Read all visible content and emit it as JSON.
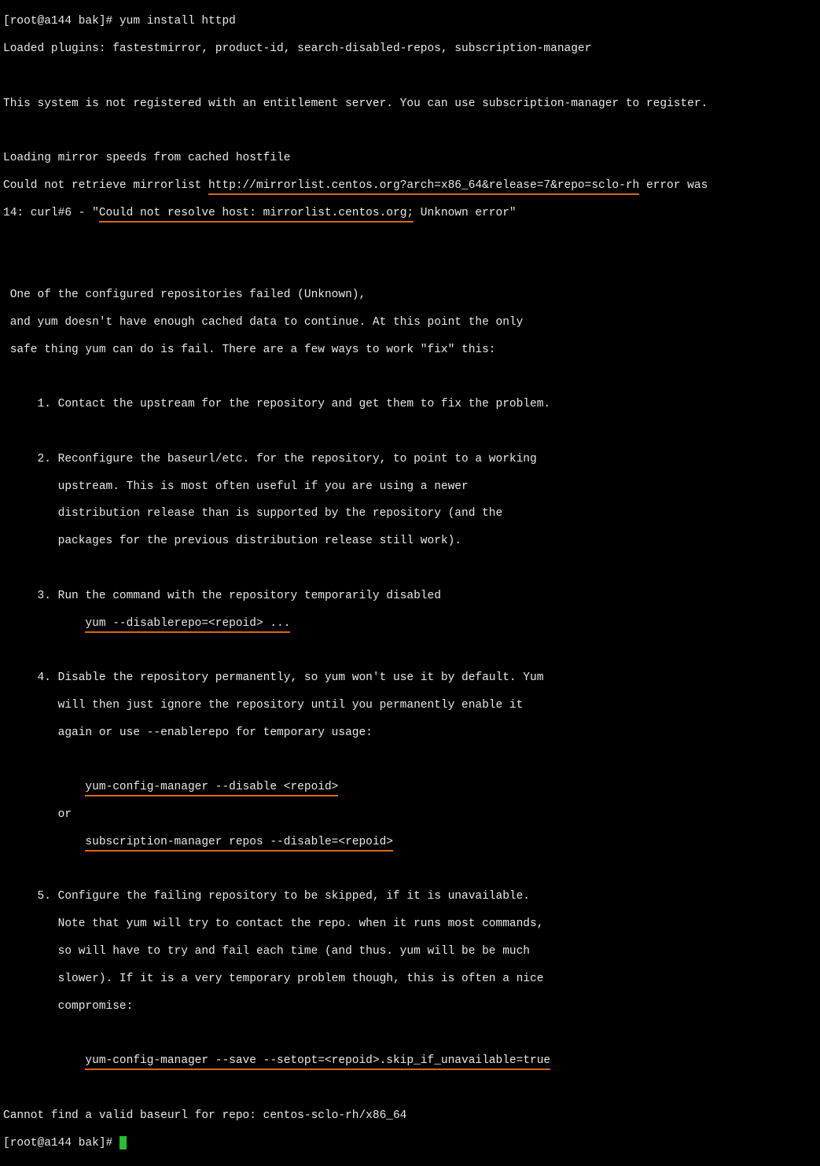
{
  "prompt1_user": "[root@a144 bak]# ",
  "cmd1": "yum install httpd",
  "line_plugins": "Loaded plugins: fastestmirror, product-id, search-disabled-repos, subscription-manager",
  "blank": "",
  "line_not_registered": "This system is not registered with an entitlement server. You can use subscription-manager to register.",
  "line_loading_mirror": "Loading mirror speeds from cached hostfile",
  "line_could_not_retrieve_pre": "Could not retrieve mirrorlist ",
  "underlined_url": "http://mirrorlist.centos.org?arch=x86_64&release=7&repo=sclo-rh",
  "line_could_not_retrieve_post": " error was",
  "line_curl_pre": "14: curl#6 - \"",
  "underlined_curl_msg": "Could not resolve host: mirrorlist.centos.org;",
  "line_curl_post": " Unknown error\"",
  "para1_l1": " One of the configured repositories failed (Unknown),",
  "para1_l2": " and yum doesn't have enough cached data to continue. At this point the only",
  "para1_l3": " safe thing yum can do is fail. There are a few ways to work \"fix\" this:",
  "opt1": "     1. Contact the upstream for the repository and get them to fix the problem.",
  "opt2_l1": "     2. Reconfigure the baseurl/etc. for the repository, to point to a working",
  "opt2_l2": "        upstream. This is most often useful if you are using a newer",
  "opt2_l3": "        distribution release than is supported by the repository (and the",
  "opt2_l4": "        packages for the previous distribution release still work).",
  "opt3_l1": "     3. Run the command with the repository temporarily disabled",
  "opt3_cmd_indent": "            ",
  "opt3_cmd": "yum --disablerepo=<repoid> ...",
  "opt4_l1": "     4. Disable the repository permanently, so yum won't use it by default. Yum",
  "opt4_l2": "        will then just ignore the repository until you permanently enable it",
  "opt4_l3": "        again or use --enablerepo for temporary usage:",
  "opt4_cmd1_indent": "            ",
  "opt4_cmd1": "yum-config-manager --disable <repoid>",
  "opt4_or": "        or",
  "opt4_cmd2_indent": "            ",
  "opt4_cmd2": "subscription-manager repos --disable=<repoid>",
  "opt5_l1": "     5. Configure the failing repository to be skipped, if it is unavailable.",
  "opt5_l2": "        Note that yum will try to contact the repo. when it runs most commands,",
  "opt5_l3": "        so will have to try and fail each time (and thus. yum will be be much",
  "opt5_l4": "        slower). If it is a very temporary problem though, this is often a nice",
  "opt5_l5": "        compromise:",
  "opt5_cmd_indent": "            ",
  "opt5_cmd": "yum-config-manager --save --setopt=<repoid>.skip_if_unavailable=true",
  "line_baseurl_err": "Cannot find a valid baseurl for repo: centos-sclo-rh/x86_64",
  "prompt2": "[root@a144 bak]# "
}
